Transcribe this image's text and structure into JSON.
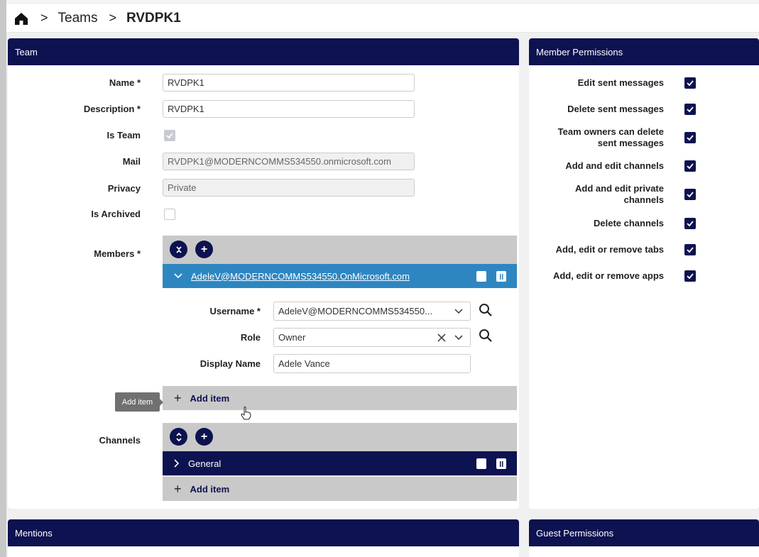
{
  "breadcrumb": {
    "level1": "Teams",
    "current": "RVDPK1"
  },
  "team_panel": {
    "title": "Team",
    "name_label": "Name *",
    "name_value": "RVDPK1",
    "description_label": "Description *",
    "description_value": "RVDPK1",
    "is_team_label": "Is Team",
    "is_team_checked": true,
    "mail_label": "Mail",
    "mail_value": "RVDPK1@MODERNCOMMS534550.onmicrosoft.com",
    "privacy_label": "Privacy",
    "privacy_value": "Private",
    "is_archived_label": "Is Archived",
    "is_archived_checked": false,
    "members_label": "Members *",
    "member_item": "AdeleV@MODERNCOMMS534550.OnMicrosoft.com",
    "username_label": "Username *",
    "username_value": "AdeleV@MODERNCOMMS534550...",
    "role_label": "Role",
    "role_value": "Owner",
    "display_name_label": "Display Name",
    "display_name_value": "Adele Vance",
    "add_item_label": "Add item",
    "tooltip": "Add item",
    "channels_label": "Channels",
    "channel_item": "General",
    "channel_add_item_label": "Add item"
  },
  "member_permissions": {
    "title": "Member Permissions",
    "items": [
      {
        "label": "Edit sent messages",
        "checked": true
      },
      {
        "label": "Delete sent messages",
        "checked": true
      },
      {
        "label": "Team owners can delete sent messages",
        "checked": true
      },
      {
        "label": "Add and edit channels",
        "checked": true
      },
      {
        "label": "Add and edit private channels",
        "checked": true
      },
      {
        "label": "Delete channels",
        "checked": true
      },
      {
        "label": "Add, edit or remove tabs",
        "checked": true
      },
      {
        "label": "Add, edit or remove apps",
        "checked": true
      }
    ]
  },
  "mentions_panel": {
    "title": "Mentions"
  },
  "guest_panel": {
    "title": "Guest Permissions"
  },
  "colors": {
    "header": "#0d1250",
    "selected_row": "#2e86c1",
    "checkbox": "#0d1250"
  }
}
